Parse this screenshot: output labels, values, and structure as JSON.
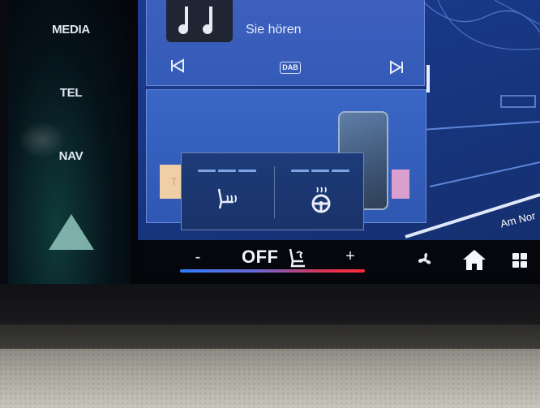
{
  "rail": {
    "media_label": "MEDIA",
    "tel_label": "TEL",
    "nav_label": "NAV"
  },
  "media": {
    "track_title": "Sie hören",
    "source_badge": "DAB"
  },
  "phone_card": {
    "sticker_text": "T"
  },
  "heat_popup": {
    "left_icon": "seat-heating-icon",
    "right_icon": "steering-wheel-heating-icon"
  },
  "map": {
    "road_label": "Am Nor"
  },
  "climate": {
    "minus_label": "-",
    "status": "OFF",
    "plus_label": "+"
  },
  "colors": {
    "map_blue": "#1b3c8f",
    "card_blue": "#3a66c6",
    "temp_cold": "#2f7cff",
    "temp_hot": "#ff2a3a"
  }
}
